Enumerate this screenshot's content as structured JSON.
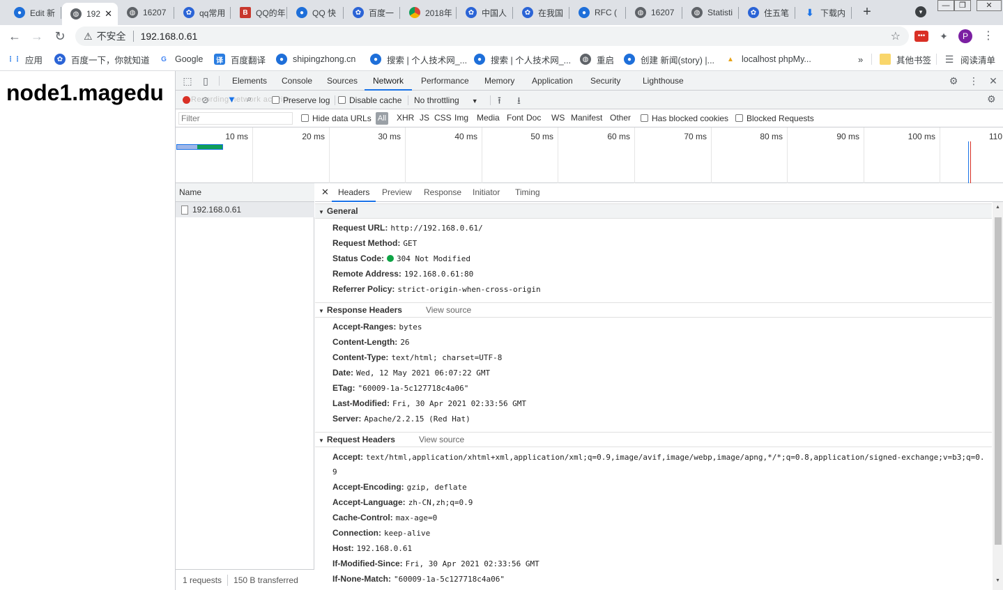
{
  "tabs": [
    {
      "label": "Edit 新",
      "icon": "drop"
    },
    {
      "label": "192",
      "icon": "globe",
      "active": true
    },
    {
      "label": "16207",
      "icon": "globe"
    },
    {
      "label": "qq常用",
      "icon": "paw"
    },
    {
      "label": "QQ的年",
      "icon": "red"
    },
    {
      "label": "QQ 快",
      "icon": "drop"
    },
    {
      "label": "百度一",
      "icon": "paw"
    },
    {
      "label": "2018年",
      "icon": "chrome"
    },
    {
      "label": "中国人",
      "icon": "paw"
    },
    {
      "label": "在我国",
      "icon": "paw"
    },
    {
      "label": "RFC (",
      "icon": "drop"
    },
    {
      "label": "16207",
      "icon": "globe"
    },
    {
      "label": "Statisti",
      "icon": "globe"
    },
    {
      "label": "住五笔",
      "icon": "paw"
    },
    {
      "label": "下载内",
      "icon": "dl"
    }
  ],
  "omnibox": {
    "security_label": "不安全",
    "url": "192.168.0.61"
  },
  "profile_initial": "P",
  "bookmarks": [
    {
      "label": "应用",
      "icon": "apps"
    },
    {
      "label": "百度一下，你就知道",
      "icon": "paw"
    },
    {
      "label": "Google",
      "icon": "google"
    },
    {
      "label": "百度翻译",
      "icon": "translate"
    },
    {
      "label": "shipingzhong.cn",
      "icon": "drop"
    },
    {
      "label": "搜索 | 个人技术网_...",
      "icon": "drop"
    },
    {
      "label": "搜索 | 个人技术网_...",
      "icon": "drop"
    },
    {
      "label": "重启",
      "icon": "globe"
    },
    {
      "label": "创建 新闻(story) |...",
      "icon": "drop"
    },
    {
      "label": "localhost phpMy...",
      "icon": "pma"
    }
  ],
  "bookmarks_right": {
    "more": "»",
    "other": "其他书签",
    "reading": "阅读清单"
  },
  "page": {
    "heading": "node1.magedu"
  },
  "devtools": {
    "tabs": [
      "Elements",
      "Console",
      "Sources",
      "Network",
      "Performance",
      "Memory",
      "Application",
      "Security",
      "Lighthouse"
    ],
    "selected_tab": "Network",
    "toolbar": {
      "preserve_log": "Preserve log",
      "disable_cache": "Disable cache",
      "throttling": "No throttling",
      "faded_hint": "Recording network activity..."
    },
    "filter": {
      "placeholder": "Filter",
      "hide_data_urls": "Hide data URLs",
      "all": "All",
      "types": [
        "XHR",
        "JS",
        "CSS",
        "Img",
        "Media",
        "Font",
        "Doc",
        "WS",
        "Manifest",
        "Other"
      ],
      "has_blocked_cookies": "Has blocked cookies",
      "blocked_requests": "Blocked Requests"
    },
    "overview": {
      "labels": [
        "10 ms",
        "20 ms",
        "30 ms",
        "40 ms",
        "50 ms",
        "60 ms",
        "70 ms",
        "80 ms",
        "90 ms",
        "100 ms",
        "110"
      ]
    },
    "name_column": "Name",
    "requests": [
      {
        "name": "192.168.0.61"
      }
    ],
    "status": {
      "requests": "1 requests",
      "transferred": "150 B transferred"
    },
    "detail_tabs": [
      "Headers",
      "Preview",
      "Response",
      "Initiator",
      "Timing"
    ],
    "selected_detail_tab": "Headers",
    "general": {
      "title": "General",
      "rows": [
        {
          "key": "Request URL:",
          "value": "http://192.168.0.61/"
        },
        {
          "key": "Request Method:",
          "value": "GET"
        },
        {
          "key": "Status Code:",
          "value": "304 Not Modified",
          "status_color": "#0ea445"
        },
        {
          "key": "Remote Address:",
          "value": "192.168.0.61:80"
        },
        {
          "key": "Referrer Policy:",
          "value": "strict-origin-when-cross-origin"
        }
      ]
    },
    "response_headers": {
      "title": "Response Headers",
      "view_source": "View source",
      "rows": [
        {
          "key": "Accept-Ranges:",
          "value": "bytes"
        },
        {
          "key": "Content-Length:",
          "value": "26"
        },
        {
          "key": "Content-Type:",
          "value": "text/html; charset=UTF-8"
        },
        {
          "key": "Date:",
          "value": "Wed, 12 May 2021 06:07:22 GMT"
        },
        {
          "key": "ETag:",
          "value": "\"60009-1a-5c127718c4a06\""
        },
        {
          "key": "Last-Modified:",
          "value": "Fri, 30 Apr 2021 02:33:56 GMT"
        },
        {
          "key": "Server:",
          "value": "Apache/2.2.15 (Red Hat)"
        }
      ]
    },
    "request_headers": {
      "title": "Request Headers",
      "view_source": "View source",
      "accept_key": "Accept:",
      "accept_value_1": "text/html,application/xhtml+xml,application/xml;q=0.9,image/avif,image/webp,image/apng,*/*;q=0.8,application/signed-exchange;v=b3;q=0.",
      "accept_value_2": "9",
      "rows": [
        {
          "key": "Accept-Encoding:",
          "value": "gzip, deflate"
        },
        {
          "key": "Accept-Language:",
          "value": "zh-CN,zh;q=0.9"
        },
        {
          "key": "Cache-Control:",
          "value": "max-age=0"
        },
        {
          "key": "Connection:",
          "value": "keep-alive"
        },
        {
          "key": "Host:",
          "value": "192.168.0.61"
        },
        {
          "key": "If-Modified-Since:",
          "value": "Fri, 30 Apr 2021 02:33:56 GMT"
        },
        {
          "key": "If-None-Match:",
          "value": "\"60009-1a-5c127718c4a06\""
        }
      ]
    }
  }
}
